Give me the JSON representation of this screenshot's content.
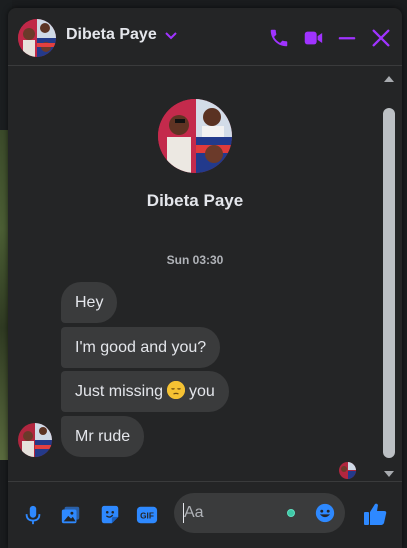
{
  "header": {
    "contact_name": "Dibeta Paye",
    "icons": [
      "phone-icon",
      "video-camera-icon",
      "minimize-icon",
      "close-icon",
      "chevron-down-icon"
    ]
  },
  "profile": {
    "name": "Dibeta Paye"
  },
  "conversation": {
    "timestamp": "Sun 03:30",
    "messages": [
      {
        "text": "Hey"
      },
      {
        "text": "I'm good and you?"
      },
      {
        "before": "Just missing",
        "emoji": "pensive-face-emoji",
        "after": "you"
      },
      {
        "text": "Mr rude"
      }
    ]
  },
  "composer": {
    "placeholder": "Aa",
    "icons": [
      "microphone-icon",
      "image-icon",
      "sticker-icon",
      "gif-icon",
      "emoji-icon",
      "thumbs-up-icon"
    ],
    "gif_label": "GIF"
  },
  "colors": {
    "accent_header": "#a033ff",
    "accent_footer": "#2e89ff",
    "bubble": "#3a3b3c",
    "window": "#242526"
  }
}
